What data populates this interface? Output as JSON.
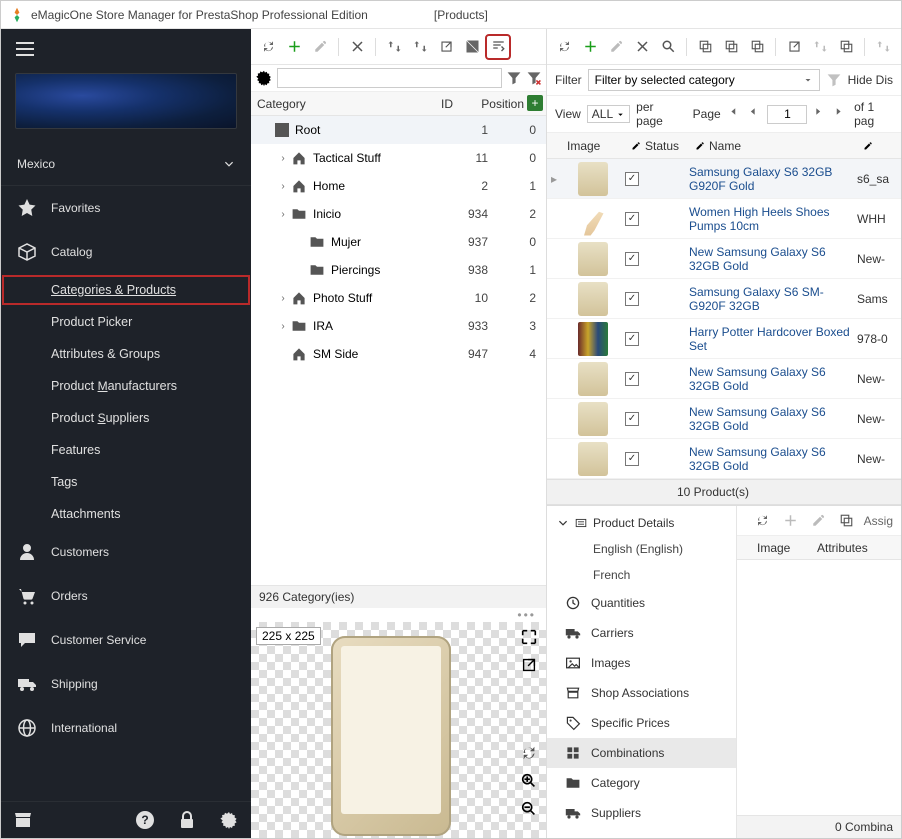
{
  "title": {
    "app": "eMagicOne Store Manager for PrestaShop Professional Edition",
    "section": "[Products]"
  },
  "sidebar": {
    "country": "Mexico",
    "nav": [
      {
        "label": "Favorites"
      },
      {
        "label": "Catalog"
      },
      {
        "label": "Customers"
      },
      {
        "label": "Orders"
      },
      {
        "label": "Customer Service"
      },
      {
        "label": "Shipping"
      },
      {
        "label": "International"
      }
    ],
    "catalog_sub": [
      "Categories & Products",
      "Product Picker",
      "Attributes & Groups",
      "Product Manufacturers",
      "Product Suppliers",
      "Features",
      "Tags",
      "Attachments"
    ]
  },
  "categories": {
    "headers": {
      "c1": "Category",
      "c2": "ID",
      "c3": "Position"
    },
    "rows": [
      {
        "name": "Root",
        "id": "1",
        "pos": "0",
        "ind": 0,
        "icon": "block",
        "tog": ""
      },
      {
        "name": "Tactical Stuff",
        "id": "11",
        "pos": "0",
        "ind": 1,
        "icon": "home",
        "tog": "›"
      },
      {
        "name": "Home",
        "id": "2",
        "pos": "1",
        "ind": 1,
        "icon": "home",
        "tog": "›"
      },
      {
        "name": "Inicio",
        "id": "934",
        "pos": "2",
        "ind": 1,
        "icon": "folder",
        "tog": "›"
      },
      {
        "name": "Mujer",
        "id": "937",
        "pos": "0",
        "ind": 2,
        "icon": "folder",
        "tog": ""
      },
      {
        "name": "Piercings",
        "id": "938",
        "pos": "1",
        "ind": 2,
        "icon": "folder",
        "tog": ""
      },
      {
        "name": "Photo Stuff",
        "id": "10",
        "pos": "2",
        "ind": 1,
        "icon": "home",
        "tog": "›"
      },
      {
        "name": "IRA",
        "id": "933",
        "pos": "3",
        "ind": 1,
        "icon": "folder",
        "tog": "›"
      },
      {
        "name": "SM Side",
        "id": "947",
        "pos": "4",
        "ind": 1,
        "icon": "home",
        "tog": ""
      }
    ],
    "status": "926 Category(ies)",
    "preview_size": "225 x 225"
  },
  "filter": {
    "label": "Filter",
    "combo": "Filter by selected category",
    "hide": "Hide Dis"
  },
  "pager": {
    "view": "View",
    "all": "ALL",
    "perpage": "per page",
    "page": "Page",
    "pagenum": "1",
    "of": "of 1 pag"
  },
  "products": {
    "headers": {
      "image": "Image",
      "status": "Status",
      "name": "Name"
    },
    "rows": [
      {
        "name": "Samsung Galaxy S6 32GB G920F Gold",
        "ref": "s6_sa",
        "thumb": "phone"
      },
      {
        "name": "Women High Heels Shoes Pumps 10cm",
        "ref": "WHH",
        "thumb": "heel"
      },
      {
        "name": "New Samsung Galaxy S6 32GB Gold",
        "ref": "New-",
        "thumb": "phone"
      },
      {
        "name": "Samsung Galaxy S6 SM-G920F 32GB",
        "ref": "Sams",
        "thumb": "phone"
      },
      {
        "name": "Harry Potter Hardcover Boxed Set",
        "ref": "978-0",
        "thumb": "books"
      },
      {
        "name": "New Samsung Galaxy S6 32GB Gold",
        "ref": "New-",
        "thumb": "phone"
      },
      {
        "name": "New Samsung Galaxy S6 32GB Gold",
        "ref": "New-",
        "thumb": "phone"
      },
      {
        "name": "New Samsung Galaxy S6 32GB Gold",
        "ref": "New-",
        "thumb": "phone"
      }
    ],
    "status": "10 Product(s)"
  },
  "details": {
    "header": "Product Details",
    "lang": [
      "English (English)",
      "French"
    ],
    "items": [
      "Quantities",
      "Carriers",
      "Images",
      "Shop Associations",
      "Specific Prices",
      "Combinations",
      "Category",
      "Suppliers"
    ],
    "toolbar_assign": "Assig",
    "grid": {
      "cols": [
        "Image",
        "Attributes"
      ],
      "status": "0 Combina"
    }
  }
}
